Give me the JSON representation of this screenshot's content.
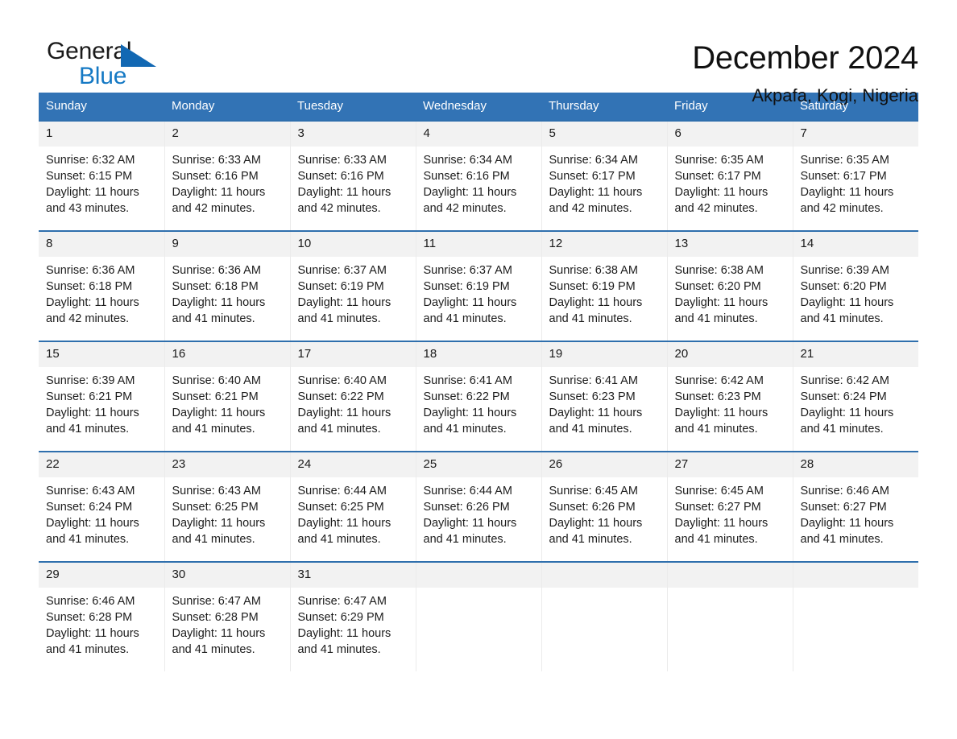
{
  "brand": {
    "name_part1": "General",
    "name_part2": "Blue",
    "triangle_icon": "triangle-icon",
    "accent_color": "#1579c4",
    "header_color": "#3273b5"
  },
  "header": {
    "title": "December 2024",
    "location": "Akpafa, Kogi, Nigeria"
  },
  "calendar": {
    "weekday_headers": [
      "Sunday",
      "Monday",
      "Tuesday",
      "Wednesday",
      "Thursday",
      "Friday",
      "Saturday"
    ],
    "weeks": [
      [
        {
          "day": "1",
          "sunrise": "Sunrise: 6:32 AM",
          "sunset": "Sunset: 6:15 PM",
          "daylight_line1": "Daylight: 11 hours",
          "daylight_line2": "and 43 minutes."
        },
        {
          "day": "2",
          "sunrise": "Sunrise: 6:33 AM",
          "sunset": "Sunset: 6:16 PM",
          "daylight_line1": "Daylight: 11 hours",
          "daylight_line2": "and 42 minutes."
        },
        {
          "day": "3",
          "sunrise": "Sunrise: 6:33 AM",
          "sunset": "Sunset: 6:16 PM",
          "daylight_line1": "Daylight: 11 hours",
          "daylight_line2": "and 42 minutes."
        },
        {
          "day": "4",
          "sunrise": "Sunrise: 6:34 AM",
          "sunset": "Sunset: 6:16 PM",
          "daylight_line1": "Daylight: 11 hours",
          "daylight_line2": "and 42 minutes."
        },
        {
          "day": "5",
          "sunrise": "Sunrise: 6:34 AM",
          "sunset": "Sunset: 6:17 PM",
          "daylight_line1": "Daylight: 11 hours",
          "daylight_line2": "and 42 minutes."
        },
        {
          "day": "6",
          "sunrise": "Sunrise: 6:35 AM",
          "sunset": "Sunset: 6:17 PM",
          "daylight_line1": "Daylight: 11 hours",
          "daylight_line2": "and 42 minutes."
        },
        {
          "day": "7",
          "sunrise": "Sunrise: 6:35 AM",
          "sunset": "Sunset: 6:17 PM",
          "daylight_line1": "Daylight: 11 hours",
          "daylight_line2": "and 42 minutes."
        }
      ],
      [
        {
          "day": "8",
          "sunrise": "Sunrise: 6:36 AM",
          "sunset": "Sunset: 6:18 PM",
          "daylight_line1": "Daylight: 11 hours",
          "daylight_line2": "and 42 minutes."
        },
        {
          "day": "9",
          "sunrise": "Sunrise: 6:36 AM",
          "sunset": "Sunset: 6:18 PM",
          "daylight_line1": "Daylight: 11 hours",
          "daylight_line2": "and 41 minutes."
        },
        {
          "day": "10",
          "sunrise": "Sunrise: 6:37 AM",
          "sunset": "Sunset: 6:19 PM",
          "daylight_line1": "Daylight: 11 hours",
          "daylight_line2": "and 41 minutes."
        },
        {
          "day": "11",
          "sunrise": "Sunrise: 6:37 AM",
          "sunset": "Sunset: 6:19 PM",
          "daylight_line1": "Daylight: 11 hours",
          "daylight_line2": "and 41 minutes."
        },
        {
          "day": "12",
          "sunrise": "Sunrise: 6:38 AM",
          "sunset": "Sunset: 6:19 PM",
          "daylight_line1": "Daylight: 11 hours",
          "daylight_line2": "and 41 minutes."
        },
        {
          "day": "13",
          "sunrise": "Sunrise: 6:38 AM",
          "sunset": "Sunset: 6:20 PM",
          "daylight_line1": "Daylight: 11 hours",
          "daylight_line2": "and 41 minutes."
        },
        {
          "day": "14",
          "sunrise": "Sunrise: 6:39 AM",
          "sunset": "Sunset: 6:20 PM",
          "daylight_line1": "Daylight: 11 hours",
          "daylight_line2": "and 41 minutes."
        }
      ],
      [
        {
          "day": "15",
          "sunrise": "Sunrise: 6:39 AM",
          "sunset": "Sunset: 6:21 PM",
          "daylight_line1": "Daylight: 11 hours",
          "daylight_line2": "and 41 minutes."
        },
        {
          "day": "16",
          "sunrise": "Sunrise: 6:40 AM",
          "sunset": "Sunset: 6:21 PM",
          "daylight_line1": "Daylight: 11 hours",
          "daylight_line2": "and 41 minutes."
        },
        {
          "day": "17",
          "sunrise": "Sunrise: 6:40 AM",
          "sunset": "Sunset: 6:22 PM",
          "daylight_line1": "Daylight: 11 hours",
          "daylight_line2": "and 41 minutes."
        },
        {
          "day": "18",
          "sunrise": "Sunrise: 6:41 AM",
          "sunset": "Sunset: 6:22 PM",
          "daylight_line1": "Daylight: 11 hours",
          "daylight_line2": "and 41 minutes."
        },
        {
          "day": "19",
          "sunrise": "Sunrise: 6:41 AM",
          "sunset": "Sunset: 6:23 PM",
          "daylight_line1": "Daylight: 11 hours",
          "daylight_line2": "and 41 minutes."
        },
        {
          "day": "20",
          "sunrise": "Sunrise: 6:42 AM",
          "sunset": "Sunset: 6:23 PM",
          "daylight_line1": "Daylight: 11 hours",
          "daylight_line2": "and 41 minutes."
        },
        {
          "day": "21",
          "sunrise": "Sunrise: 6:42 AM",
          "sunset": "Sunset: 6:24 PM",
          "daylight_line1": "Daylight: 11 hours",
          "daylight_line2": "and 41 minutes."
        }
      ],
      [
        {
          "day": "22",
          "sunrise": "Sunrise: 6:43 AM",
          "sunset": "Sunset: 6:24 PM",
          "daylight_line1": "Daylight: 11 hours",
          "daylight_line2": "and 41 minutes."
        },
        {
          "day": "23",
          "sunrise": "Sunrise: 6:43 AM",
          "sunset": "Sunset: 6:25 PM",
          "daylight_line1": "Daylight: 11 hours",
          "daylight_line2": "and 41 minutes."
        },
        {
          "day": "24",
          "sunrise": "Sunrise: 6:44 AM",
          "sunset": "Sunset: 6:25 PM",
          "daylight_line1": "Daylight: 11 hours",
          "daylight_line2": "and 41 minutes."
        },
        {
          "day": "25",
          "sunrise": "Sunrise: 6:44 AM",
          "sunset": "Sunset: 6:26 PM",
          "daylight_line1": "Daylight: 11 hours",
          "daylight_line2": "and 41 minutes."
        },
        {
          "day": "26",
          "sunrise": "Sunrise: 6:45 AM",
          "sunset": "Sunset: 6:26 PM",
          "daylight_line1": "Daylight: 11 hours",
          "daylight_line2": "and 41 minutes."
        },
        {
          "day": "27",
          "sunrise": "Sunrise: 6:45 AM",
          "sunset": "Sunset: 6:27 PM",
          "daylight_line1": "Daylight: 11 hours",
          "daylight_line2": "and 41 minutes."
        },
        {
          "day": "28",
          "sunrise": "Sunrise: 6:46 AM",
          "sunset": "Sunset: 6:27 PM",
          "daylight_line1": "Daylight: 11 hours",
          "daylight_line2": "and 41 minutes."
        }
      ],
      [
        {
          "day": "29",
          "sunrise": "Sunrise: 6:46 AM",
          "sunset": "Sunset: 6:28 PM",
          "daylight_line1": "Daylight: 11 hours",
          "daylight_line2": "and 41 minutes."
        },
        {
          "day": "30",
          "sunrise": "Sunrise: 6:47 AM",
          "sunset": "Sunset: 6:28 PM",
          "daylight_line1": "Daylight: 11 hours",
          "daylight_line2": "and 41 minutes."
        },
        {
          "day": "31",
          "sunrise": "Sunrise: 6:47 AM",
          "sunset": "Sunset: 6:29 PM",
          "daylight_line1": "Daylight: 11 hours",
          "daylight_line2": "and 41 minutes."
        },
        {
          "day": "",
          "sunrise": "",
          "sunset": "",
          "daylight_line1": "",
          "daylight_line2": ""
        },
        {
          "day": "",
          "sunrise": "",
          "sunset": "",
          "daylight_line1": "",
          "daylight_line2": ""
        },
        {
          "day": "",
          "sunrise": "",
          "sunset": "",
          "daylight_line1": "",
          "daylight_line2": ""
        },
        {
          "day": "",
          "sunrise": "",
          "sunset": "",
          "daylight_line1": "",
          "daylight_line2": ""
        }
      ]
    ]
  }
}
